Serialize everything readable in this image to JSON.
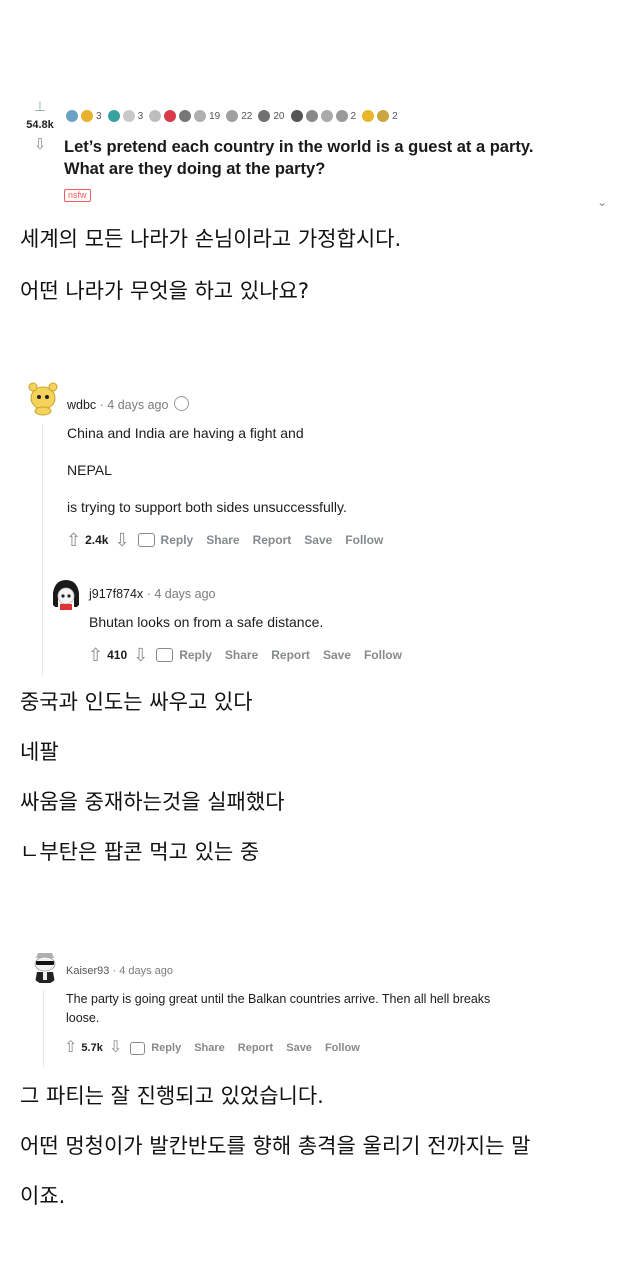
{
  "post": {
    "score": "54.8k",
    "awards": [
      {
        "icon": "award-silver-icon",
        "color": "#6aa2c6",
        "count": ""
      },
      {
        "icon": "award-gold-icon",
        "color": "#e8b12f",
        "count": "3"
      },
      {
        "icon": "award-wholesome-icon",
        "color": "#3aa0a0",
        "count": ""
      },
      {
        "icon": "award-hand-icon",
        "color": "#c9c9c9",
        "count": "3"
      },
      {
        "icon": "award-plane-icon",
        "color": "#bdbdbd",
        "count": ""
      },
      {
        "icon": "award-heart-icon",
        "color": "#d83a4a",
        "count": ""
      },
      {
        "icon": "award-arrow-icon",
        "color": "#777777",
        "count": ""
      },
      {
        "icon": "award-helpful-icon",
        "color": "#b0b0b0",
        "count": "19"
      },
      {
        "icon": "award-laugh-icon",
        "color": "#a0a0a0",
        "count": "22"
      },
      {
        "icon": "award-coin-icon",
        "color": "#707070",
        "count": "20"
      },
      {
        "icon": "award-face-icon",
        "color": "#555555",
        "count": ""
      },
      {
        "icon": "award-party-icon",
        "color": "#888888",
        "count": ""
      },
      {
        "icon": "award-thumb-icon",
        "color": "#aaaaaa",
        "count": ""
      },
      {
        "icon": "award-rocket-icon",
        "color": "#999999",
        "count": "2"
      },
      {
        "icon": "award-gold-face-icon",
        "color": "#e9b52a",
        "count": ""
      },
      {
        "icon": "award-platinum-icon",
        "color": "#c9a640",
        "count": "2"
      }
    ],
    "title_line1": "Let’s pretend each country in the world is a guest at a party.",
    "title_line2": "What are they doing at the party?",
    "tag": "nsfw"
  },
  "captions": {
    "c1": "세계의 모든 나라가 손님이라고 가정합시다.",
    "c2": "어떤 나라가 무엇을 하고 있나요?",
    "c3": "중국과 인도는 싸우고 있다",
    "c4": "네팔",
    "c5": "싸움을 중재하는것을 실패했다",
    "c6": "ㄴ부탄은 팝콘 먹고 있는 중",
    "c7": "그 파티는 잘 진행되고 있었습니다.",
    "c8": "어떤 멍청이가 발칸반도를 향해 총격을 울리기 전까지는 말",
    "c9": "이죠."
  },
  "comment1": {
    "user": "wdbc",
    "time": "· 4 days ago",
    "lines": [
      "China and India are having a fight and",
      "NEPAL",
      "is trying to support both sides unsuccessfully."
    ],
    "score": "2.4k",
    "actions": [
      "Reply",
      "Share",
      "Report",
      "Save",
      "Follow"
    ]
  },
  "comment2": {
    "user": "j917f874x",
    "time": "· 4 days ago",
    "text": "Bhutan looks on from a safe distance.",
    "score": "410",
    "actions": [
      "Reply",
      "Share",
      "Report",
      "Save",
      "Follow"
    ]
  },
  "comment3": {
    "user": "Kaiser93",
    "time": "· 4 days ago",
    "line1": "The party is going great until the Balkan countries arrive. Then all hell breaks",
    "line2": "loose.",
    "score": "5.7k",
    "actions": [
      "Reply",
      "Share",
      "Report",
      "Save",
      "Follow"
    ]
  }
}
